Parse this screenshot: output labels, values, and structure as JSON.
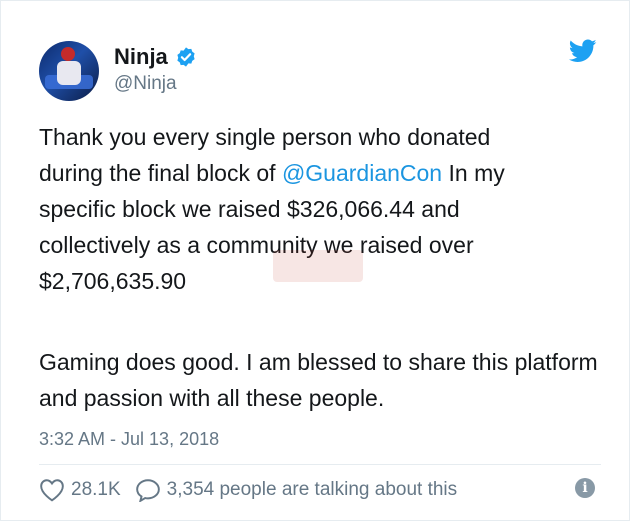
{
  "user": {
    "display_name": "Ninja",
    "handle": "@Ninja",
    "verified": true
  },
  "tweet": {
    "line1_pre": "Thank you every single person who donated\nduring the final block of ",
    "mention": "@GuardianCon",
    "line1_post": " In my\nspecific block we raised $326,066.44 and\ncollectively as a community we raised over\n$2,706,635.90",
    "paragraph2": "Gaming does good. I am blessed to share this platform and passion with all these people."
  },
  "timestamp": "3:32 AM - Jul 13, 2018",
  "actions": {
    "likes": "28.1K",
    "talking": "3,354 people are talking about this"
  },
  "icons": {
    "twitter_bird": "twitter-bird-icon",
    "verified": "verified-badge-icon",
    "heart": "heart-icon",
    "comment": "comment-bubble-icon",
    "info": "info-icon"
  },
  "colors": {
    "accent": "#1da1f2",
    "link": "#1b95e0",
    "muted": "#657786"
  }
}
